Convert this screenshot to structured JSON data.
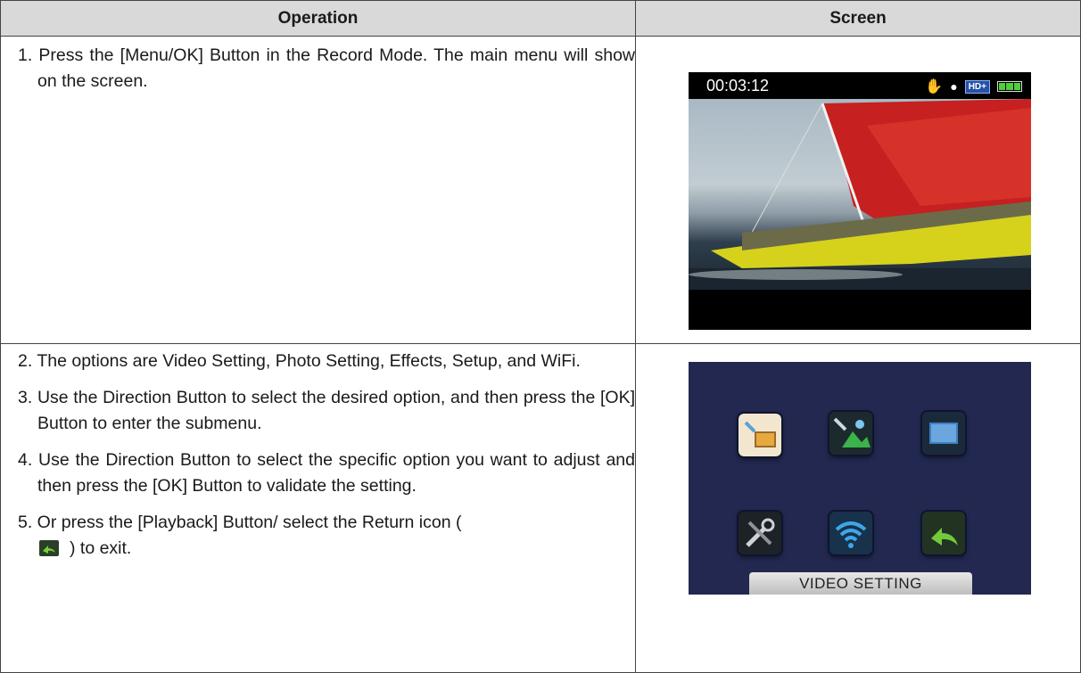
{
  "header": {
    "operation": "Operation",
    "screen": "Screen"
  },
  "row1": {
    "step1": "1. Press the [Menu/OK] Button in the Record Mode. The main menu will show on the screen."
  },
  "screen1": {
    "timecode": "00:03:12",
    "quality_badge": "HD+"
  },
  "row2": {
    "step2": "2. The options are Video Setting, Photo Setting, Effects, Setup, and WiFi.",
    "step3": "3. Use the Direction Button to select the desired option, and then press the [OK] Button to enter the submenu.",
    "step4": "4. Use the Direction Button to select the specific option you want to adjust and then press the [OK] Button to validate the setting.",
    "step5_a": "5. Or press the [Playback] Button/ select the Return icon (",
    "step5_b": ") to exit."
  },
  "screen2": {
    "selected_label": "VIDEO SETTING",
    "icons": [
      "video-setting-icon",
      "photo-setting-icon",
      "effects-icon",
      "setup-icon",
      "wifi-icon",
      "return-icon"
    ]
  },
  "colors": {
    "header_bg": "#d9d9d9",
    "menu_bg": "#22284f",
    "sail_red": "#c62020",
    "hull_yellow": "#d6d21c"
  }
}
